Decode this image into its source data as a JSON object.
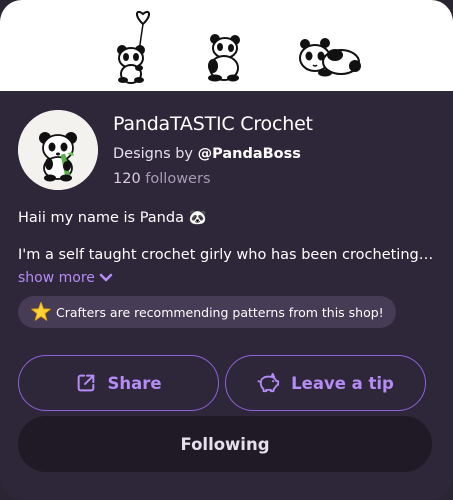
{
  "shop": {
    "name": "PandaTASTIC Crochet",
    "designs_prefix": "Designs by",
    "designer_handle": "@PandaBoss",
    "followers_count": "120",
    "followers_label": "followers"
  },
  "bio": {
    "greeting": "Haii my name is Panda 🐼",
    "about": "I'm a self taught crochet girly who has been crocheting for years and years and years",
    "show_more_label": "show more"
  },
  "badge": {
    "icon": "star-icon",
    "text": "Crafters are recommending patterns from this shop!"
  },
  "actions": {
    "share_label": "Share",
    "tip_label": "Leave a tip",
    "following_label": "Following"
  },
  "colors": {
    "background": "#2e2639",
    "accent": "#b58cf5",
    "button_border": "#8f62d9",
    "badge_bg": "#463c55",
    "following_bg": "#1f1a26"
  }
}
